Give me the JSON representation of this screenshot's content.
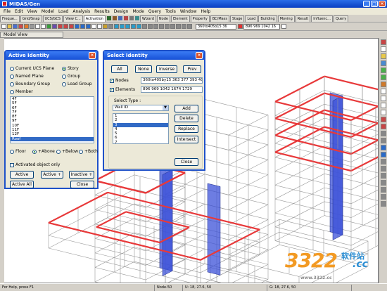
{
  "window": {
    "title": "MIDAS/Gen",
    "minimize": "_",
    "maximize": "□",
    "close": "×"
  },
  "menu": [
    "File",
    "Edit",
    "View",
    "Model",
    "Load",
    "Analysis",
    "Results",
    "Design",
    "Mode",
    "Query",
    "Tools",
    "Window",
    "Help"
  ],
  "tabs": [
    "Freque...",
    "Grid/Snap",
    "UCS/GCS",
    "View C...",
    "Activation",
    "Wizard",
    "Node",
    "Element",
    "Property",
    "BC/Mass",
    "Stage",
    "Load",
    "Building",
    "Moving",
    "Result",
    "Influenc...",
    "Query"
  ],
  "toolbar": {
    "node_field": "360to405b15 36",
    "elem_field": "896 969 1042 16"
  },
  "doc_tab": "Model View",
  "active_identity": {
    "title": "Active Identity",
    "radios": [
      "Current UCS Plane",
      "Story",
      "Named Plane",
      "Group",
      "Boundary Group",
      "Load Group",
      "Member"
    ],
    "stories": [
      "4F",
      "5F",
      "6F",
      "7F",
      "8F",
      "9F",
      "10F",
      "11F",
      "12F",
      "Roof"
    ],
    "selected_story": "Roof",
    "floor_options": [
      "Floor",
      "+Above",
      "+Below",
      "+Both"
    ],
    "activated_only": "Activated object only",
    "buttons": {
      "active": "Active",
      "active_plus": "Active +",
      "inactive_plus": "Inactive +",
      "active_all": "Active All",
      "close": "Close"
    }
  },
  "select_identity": {
    "title": "Select Identity",
    "buttons": {
      "all": "All",
      "none": "None",
      "inverse": "Inverse",
      "prev": "Prev"
    },
    "nodes_label": "Nodes",
    "nodes_value": "360to405by15 363 377 393 406",
    "elements_label": "Elements",
    "elements_value": "896 969 1042 1674 1729",
    "select_type_label": "Select Type :",
    "select_type_value": "Wall ID",
    "type_items": [
      "1",
      "2",
      "3",
      "4",
      "5",
      "6",
      "7"
    ],
    "selected_item": "3",
    "side_buttons": {
      "add": "Add",
      "delete": "Delete",
      "replace": "Replace",
      "intersect": "Intersect"
    },
    "close": "Close"
  },
  "status": {
    "help": "For Help, press F1",
    "node": "Node-50",
    "u": "U: 18, 27.6, 50",
    "g": "G: 18, 27.6, 50"
  },
  "watermark": {
    "site": "软件站",
    "logo": "3322",
    "tld": ".cc",
    "url": "www.3322.cc"
  },
  "colors": {
    "beam": "#e8393a",
    "wall": "#3c52d8",
    "grid": "#9a9a9a",
    "accent": "#1f51c9"
  }
}
